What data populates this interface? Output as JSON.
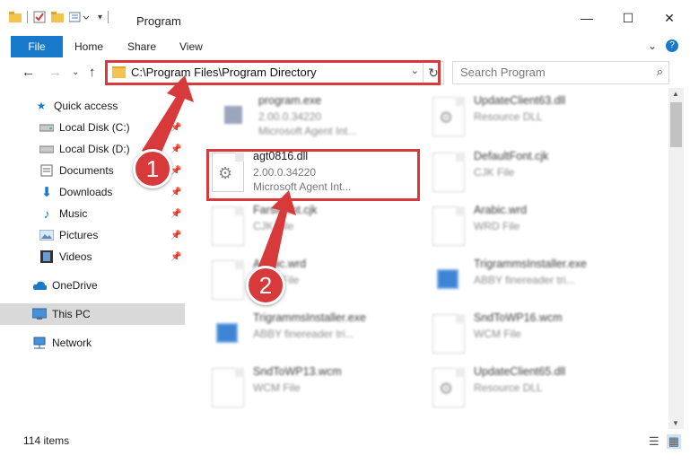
{
  "window": {
    "title": "Program",
    "minimize": "—",
    "maximize": "☐",
    "close": "✕"
  },
  "ribbon": {
    "file": "File",
    "home": "Home",
    "share": "Share",
    "view": "View",
    "expand": "⌄",
    "help": "?"
  },
  "nav": {
    "back": "←",
    "forward": "→",
    "recent": "⌄",
    "up": "↑",
    "address": "C:\\Program Files\\Program Directory",
    "refresh": "↻",
    "search_placeholder": "Search Program",
    "search_icon": "⌕"
  },
  "sidebar": {
    "items": [
      {
        "label": "Quick access",
        "icon": "star-icon"
      },
      {
        "label": "Local Disk (C:)",
        "icon": "drive-icon",
        "pinned": true
      },
      {
        "label": "Local Disk (D:)",
        "icon": "drive-icon",
        "pinned": true
      },
      {
        "label": "Documents",
        "icon": "documents-icon",
        "pinned": true
      },
      {
        "label": "Downloads",
        "icon": "download-icon",
        "pinned": true
      },
      {
        "label": "Music",
        "icon": "music-icon",
        "pinned": true
      },
      {
        "label": "Pictures",
        "icon": "pictures-icon",
        "pinned": true
      },
      {
        "label": "Videos",
        "icon": "videos-icon",
        "pinned": true
      },
      {
        "label": "OneDrive",
        "icon": "cloud-icon"
      },
      {
        "label": "This PC",
        "icon": "computer-icon",
        "selected": true
      },
      {
        "label": "Network",
        "icon": "network-icon"
      }
    ]
  },
  "files": [
    {
      "name": "program.exe",
      "line1": "2.00.0.34220",
      "line2": "Microsoft Agent Int...",
      "icon": "exe"
    },
    {
      "name": "UpdateClient63.dll",
      "line1": "Resource DLL",
      "line2": "",
      "icon": "dll"
    },
    {
      "name": "agt0816.dll",
      "line1": "2.00.0.34220",
      "line2": "Microsoft Agent Int...",
      "icon": "dll"
    },
    {
      "name": "DefaultFont.cjk",
      "line1": "CJK File",
      "line2": "",
      "icon": "blank"
    },
    {
      "name": "FarsiFont.cjk",
      "line1": "CJK File",
      "line2": "",
      "icon": "blank"
    },
    {
      "name": "Arabic.wrd",
      "line1": "WRD File",
      "line2": "",
      "icon": "blank"
    },
    {
      "name": "Arabic.wrd",
      "line1": "WRD File",
      "line2": "",
      "icon": "blank"
    },
    {
      "name": "TrigrammsInstaller.exe",
      "line1": "ABBY finereader tri...",
      "line2": "",
      "icon": "installer"
    },
    {
      "name": "TrigrammsInstaller.exe",
      "line1": "ABBY finereader tri...",
      "line2": "",
      "icon": "installer"
    },
    {
      "name": "SndToWP16.wcm",
      "line1": "WCM File",
      "line2": "",
      "icon": "blank"
    },
    {
      "name": "SndToWP13.wcm",
      "line1": "WCM File",
      "line2": "",
      "icon": "blank"
    },
    {
      "name": "UpdateClient65.dll",
      "line1": "Resource DLL",
      "line2": "",
      "icon": "dll"
    }
  ],
  "callouts": [
    "1",
    "2"
  ],
  "status": {
    "count": "114 items"
  },
  "colors": {
    "accent": "#1979ca",
    "highlight": "#d8393b",
    "selected": "#d9d9d9"
  }
}
